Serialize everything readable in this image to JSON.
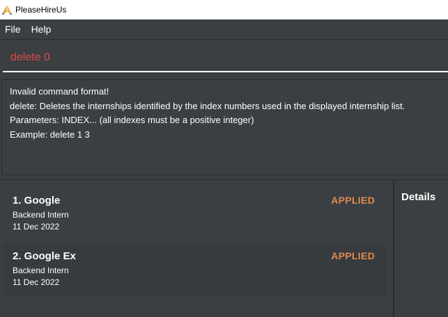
{
  "app": {
    "title": "PleaseHireUs"
  },
  "menu": {
    "items": [
      "File",
      "Help"
    ]
  },
  "command": {
    "value": "delete 0"
  },
  "result": {
    "text": "Invalid command format!\ndelete: Deletes the internships identified by the index numbers used in the displayed internship list.\nParameters: INDEX... (all indexes must be a positive integer)\nExample: delete 1 3"
  },
  "internships": [
    {
      "title": "1.  Google",
      "role": "Backend Intern",
      "date": "11 Dec 2022",
      "status": "APPLIED"
    },
    {
      "title": "2.  Google Ex",
      "role": "Backend Intern",
      "date": "11 Dec 2022",
      "status": "APPLIED"
    }
  ],
  "details": {
    "title": "Details"
  },
  "colors": {
    "background": "#3c3f41",
    "command_text": "#e04848",
    "status_applied": "#e08a4f"
  }
}
